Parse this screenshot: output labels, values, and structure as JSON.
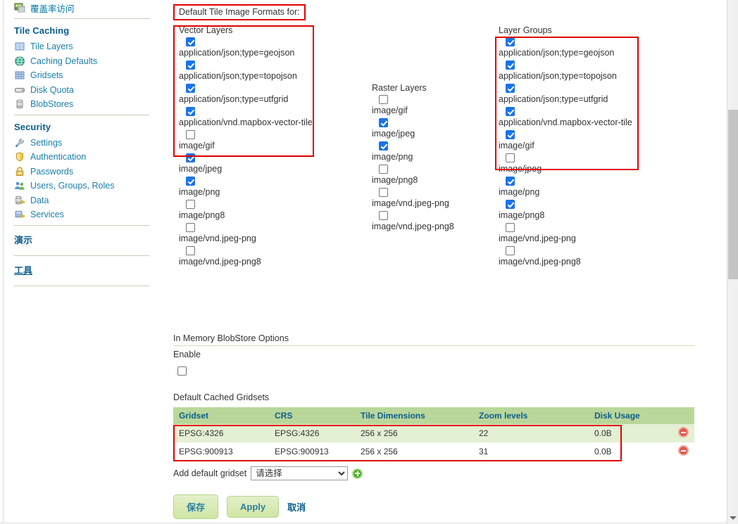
{
  "sidebar": {
    "top_item": {
      "icon": "coverage-access-icon",
      "label": "覆盖率访问"
    },
    "groups": [
      {
        "title": "Tile Caching",
        "items": [
          {
            "icon": "tile-layers-icon",
            "label": "Tile Layers"
          },
          {
            "icon": "globe-icon",
            "label": "Caching Defaults"
          },
          {
            "icon": "gridsets-icon",
            "label": "Gridsets"
          },
          {
            "icon": "disk-quota-icon",
            "label": "Disk Quota"
          },
          {
            "icon": "blobstores-icon",
            "label": "BlobStores"
          }
        ]
      },
      {
        "title": "Security",
        "items": [
          {
            "icon": "wrench-icon",
            "label": "Settings"
          },
          {
            "icon": "shield-icon",
            "label": "Authentication"
          },
          {
            "icon": "lock-icon",
            "label": "Passwords"
          },
          {
            "icon": "users-icon",
            "label": "Users, Groups, Roles"
          },
          {
            "icon": "data-key-icon",
            "label": "Data"
          },
          {
            "icon": "services-key-icon",
            "label": "Services"
          }
        ]
      }
    ],
    "links": [
      {
        "label": "演示",
        "underlined": false
      },
      {
        "label": "工具",
        "underlined": true
      }
    ]
  },
  "main": {
    "section_title": "Default Tile Image Formats for:",
    "columns": [
      {
        "key": "vector",
        "heading": "Vector Layers",
        "formats": [
          {
            "label": "application/json;type=geojson",
            "checked": true
          },
          {
            "label": "application/json;type=topojson",
            "checked": true
          },
          {
            "label": "application/json;type=utfgrid",
            "checked": true
          },
          {
            "label": "application/vnd.mapbox-vector-tile",
            "checked": true
          },
          {
            "label": "image/gif",
            "checked": false
          },
          {
            "label": "image/jpeg",
            "checked": true
          },
          {
            "label": "image/png",
            "checked": true
          },
          {
            "label": "image/png8",
            "checked": false
          },
          {
            "label": "image/vnd.jpeg-png",
            "checked": false
          },
          {
            "label": "image/vnd.jpeg-png8",
            "checked": false
          }
        ]
      },
      {
        "key": "raster",
        "heading": "Raster Layers",
        "formats": [
          {
            "label": "image/gif",
            "checked": false
          },
          {
            "label": "image/jpeg",
            "checked": true
          },
          {
            "label": "image/png",
            "checked": true
          },
          {
            "label": "image/png8",
            "checked": false
          },
          {
            "label": "image/vnd.jpeg-png",
            "checked": false
          },
          {
            "label": "image/vnd.jpeg-png8",
            "checked": false
          }
        ]
      },
      {
        "key": "layergroups",
        "heading": "Layer Groups",
        "formats": [
          {
            "label": "application/json;type=geojson",
            "checked": true
          },
          {
            "label": "application/json;type=topojson",
            "checked": true
          },
          {
            "label": "application/json;type=utfgrid",
            "checked": true
          },
          {
            "label": "application/vnd.mapbox-vector-tile",
            "checked": true
          },
          {
            "label": "image/gif",
            "checked": true
          },
          {
            "label": "image/jpeg",
            "checked": false
          },
          {
            "label": "image/png",
            "checked": true
          },
          {
            "label": "image/png8",
            "checked": true
          },
          {
            "label": "image/vnd.jpeg-png",
            "checked": false
          },
          {
            "label": "image/vnd.jpeg-png8",
            "checked": false
          }
        ]
      }
    ],
    "blobstore": {
      "heading": "In Memory BlobStore Options",
      "enable_label": "Enable",
      "enable_checked": false
    },
    "gridsets": {
      "heading": "Default Cached Gridsets",
      "columns": [
        "Gridset",
        "CRS",
        "Tile Dimensions",
        "Zoom levels",
        "Disk Usage"
      ],
      "rows": [
        {
          "gridset": "EPSG:4326",
          "crs": "EPSG:4326",
          "tile_dimensions": "256 x 256",
          "zoom_levels": "22",
          "disk_usage": "0.0B",
          "remove_icon": "remove-icon"
        },
        {
          "gridset": "EPSG:900913",
          "crs": "EPSG:900913",
          "tile_dimensions": "256 x 256",
          "zoom_levels": "31",
          "disk_usage": "0.0B",
          "remove_icon": "remove-icon"
        }
      ],
      "add_label": "Add default gridset",
      "add_select_value": "请选择",
      "add_icon": "add-icon"
    },
    "buttons": {
      "save": "保存",
      "apply": "Apply",
      "cancel": "取消"
    }
  },
  "colors": {
    "highlight": "#e00000",
    "checkbox_on": "#1a73e8",
    "table_header": "#b9d79b",
    "table_row_alt": "#e4f0d4",
    "link": "#1b7fa8",
    "heading": "#0b5c8c"
  }
}
